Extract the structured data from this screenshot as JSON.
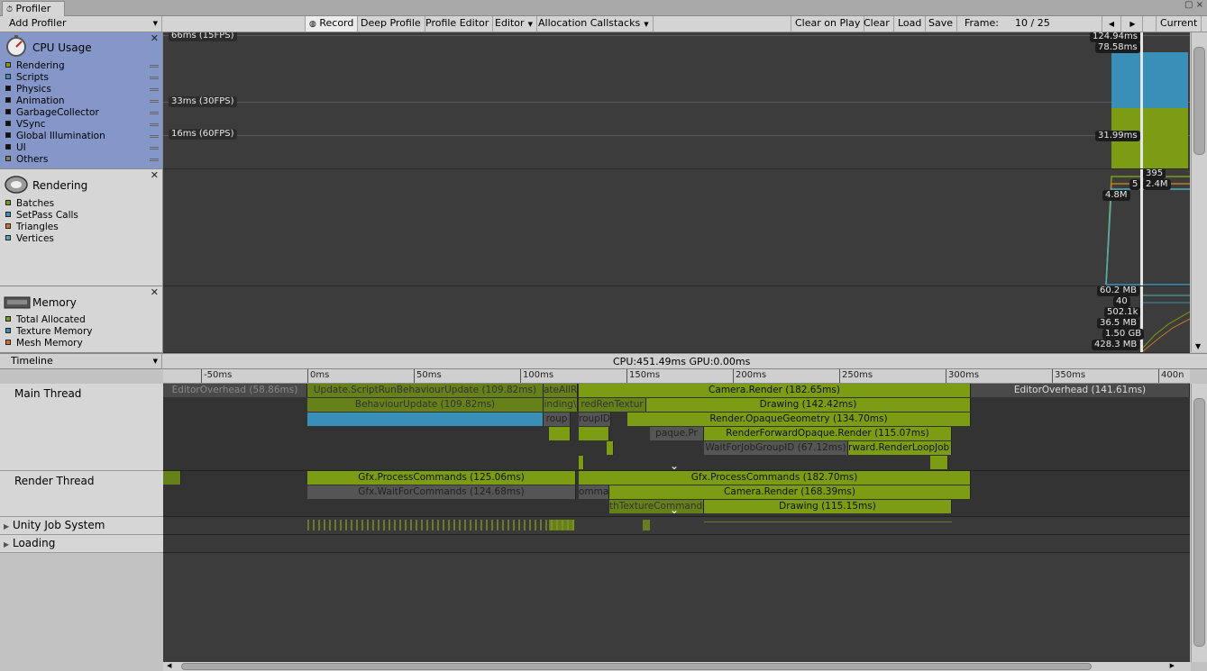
{
  "window": {
    "tab_title": "Profiler",
    "controls": "▢ ×"
  },
  "toolbar": {
    "add_profiler": "Add Profiler",
    "record": "Record",
    "deep_profile": "Deep Profile",
    "profile_editor": "Profile Editor",
    "editor": "Editor",
    "allocation_callstacks": "Allocation Callstacks",
    "clear_on_play": "Clear on Play",
    "clear": "Clear",
    "load": "Load",
    "save": "Save",
    "frame_label": "Frame:",
    "frame_value": "10 / 25",
    "current": "Current"
  },
  "cpu": {
    "title": "CPU Usage",
    "legend": [
      "Rendering",
      "Scripts",
      "Physics",
      "Animation",
      "GarbageCollector",
      "VSync",
      "Global Illumination",
      "UI",
      "Others"
    ],
    "legend_colors": [
      "#7c9c14",
      "#3a8fb8",
      "#111111",
      "#111111",
      "#111111",
      "#111111",
      "#111111",
      "#111111",
      "#7f7f5f"
    ],
    "lines": [
      "66ms (15FPS)",
      "33ms (30FPS)",
      "16ms (60FPS)"
    ],
    "values": [
      "124.94ms",
      "78.58ms",
      "31.99ms"
    ]
  },
  "rendering": {
    "title": "Rendering",
    "legend": [
      "Batches",
      "SetPass Calls",
      "Triangles",
      "Vertices"
    ],
    "legend_colors": [
      "#7c9c14",
      "#3a8fb8",
      "#c87820",
      "#4cb0b8"
    ],
    "values": [
      "395",
      "5",
      "2.4M",
      "4.8M"
    ]
  },
  "memory": {
    "title": "Memory",
    "legend": [
      "Total Allocated",
      "Texture Memory",
      "Mesh Memory"
    ],
    "legend_colors": [
      "#7c9c14",
      "#3a8fb8",
      "#c87820"
    ],
    "values": [
      "60.2 MB",
      "40",
      "502.1k",
      "36.5 MB",
      "1.50 GB",
      "428.3 MB"
    ]
  },
  "timeline": {
    "mode": "Timeline",
    "stats": "CPU:451.49ms   GPU:0.00ms",
    "ticks": [
      "-50ms",
      "0ms",
      "50ms",
      "100ms",
      "150ms",
      "200ms",
      "250ms",
      "300ms",
      "350ms",
      "400n"
    ],
    "lanes": {
      "main": "Main Thread",
      "render": "Render Thread",
      "jobs": "Unity Job System",
      "loading": "Loading"
    },
    "main_bars": {
      "overhead_left": "EditorOverhead (58.86ms)",
      "update": "Update.ScriptRunBehaviourUpdate (109.82ms)",
      "cut1": "ateAllR",
      "camera_render": "Camera.Render (182.65ms)",
      "overhead_right": "EditorOverhead (141.61ms)",
      "behaviour": "BehaviourUpdate (109.82ms)",
      "cut2": "inding\\",
      "cut3": "redRenTextur",
      "drawing": "Drawing (142.42ms)",
      "cut4": "roup",
      "cut5": "roupID",
      "opaque_geometry": "Render.OpaqueGeometry (134.70ms)",
      "cut6": "paque.Pr",
      "forward_opaque": "RenderForwardOpaque.Render (115.07ms)",
      "wait_job": "WaitForJobGroupID (67.12ms)",
      "cut7": "rward.RenderLoopJob (4"
    },
    "render_bars": {
      "process1": "Gfx.ProcessCommands (125.06ms)",
      "process2": "Gfx.ProcessCommands (182.70ms)",
      "wait": "Gfx.WaitForCommands (124.68ms)",
      "cut1": "omman",
      "camera": "Camera.Render (168.39ms)",
      "cut2": "thTextureCommands",
      "drawing": "Drawing (115.15ms)"
    }
  }
}
